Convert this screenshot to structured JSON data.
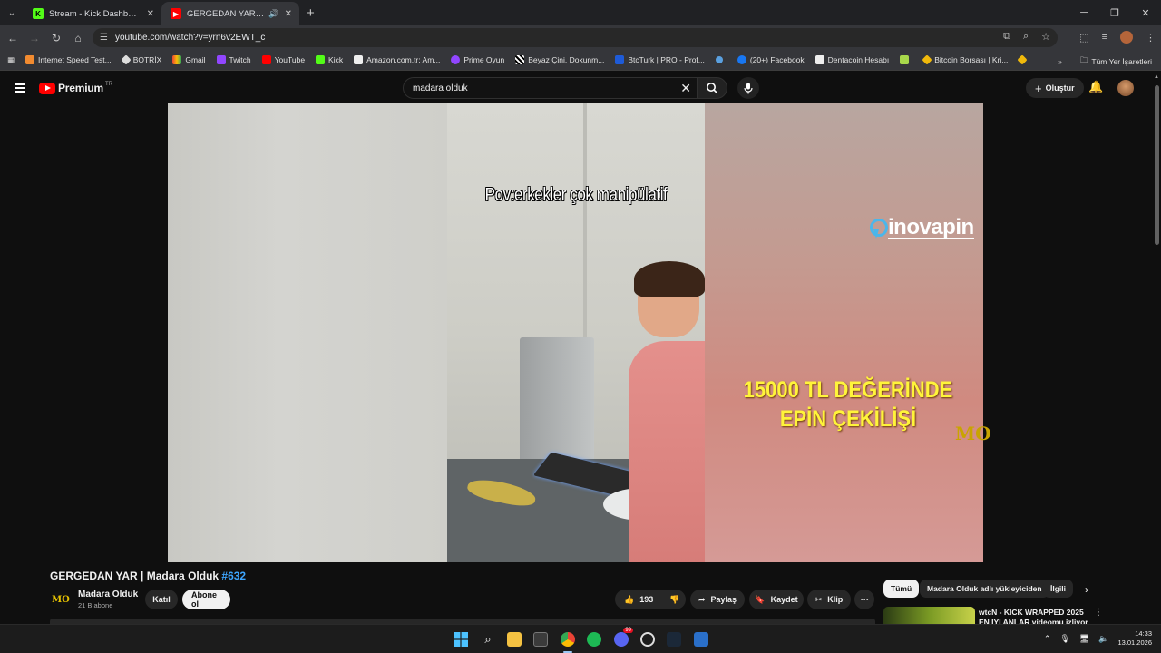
{
  "browser": {
    "tabs": [
      {
        "title": "Stream - Kick Dashboard",
        "active": false
      },
      {
        "title": "GERGEDAN YAR | Madara Olduk #632 - YouTube",
        "active": true
      }
    ],
    "url": "youtube.com/watch?v=yrn6v2EWT_c",
    "bookmarks": [
      "Internet Speed Test...",
      "BOTRİX",
      "Gmail",
      "Twitch",
      "YouTube",
      "Kick",
      "Amazon.com.tr: Am...",
      "Prime Oyun",
      "Beyaz Çini, Dokunm...",
      "BtcTurk | PRO - Prof...",
      "",
      "(20+) Facebook",
      "Dentacoin Hesabı",
      "",
      "Bitcoin Borsası | Kri..."
    ],
    "all_bookmarks_label": "Tüm Yer İşaretleri"
  },
  "youtube": {
    "brand": "Premium",
    "region": "TR",
    "search_query": "madara olduk",
    "create_label": "Oluştur"
  },
  "video": {
    "overlay_caption": "Pov:erkekler çok manipülatif",
    "sponsor_name": "inovapin",
    "promo_line1": "15000 TL DEĞERİNDE",
    "promo_line2": "EPİN ÇEKİLİŞİ",
    "channel_watermark": "MO",
    "title_main": "GERGEDAN YAR | Madara Olduk ",
    "title_hashtag": "#632",
    "channel_name": "Madara Olduk",
    "channel_logo_text": "MO",
    "subscribers": "21 B abone",
    "join_label": "Katıl",
    "subscribe_label": "Abone ol",
    "likes": "193",
    "share_label": "Paylaş",
    "save_label": "Kaydet",
    "clip_label": "Klip"
  },
  "recommendations": {
    "chips": [
      "Tümü",
      "Madara Olduk adlı yükleyiciden",
      "İlgili"
    ],
    "first_title": "wtcN - KİCK WRAPPED 2025 EN İYİ ANLAR videomu izliyor"
  },
  "taskbar": {
    "time": "14:33",
    "date": "13.01.2026",
    "notification_badge": "99"
  },
  "colors": {
    "accent_red": "#ff0000",
    "link_blue": "#3ea6ff",
    "promo_yellow": "#fff43a"
  }
}
